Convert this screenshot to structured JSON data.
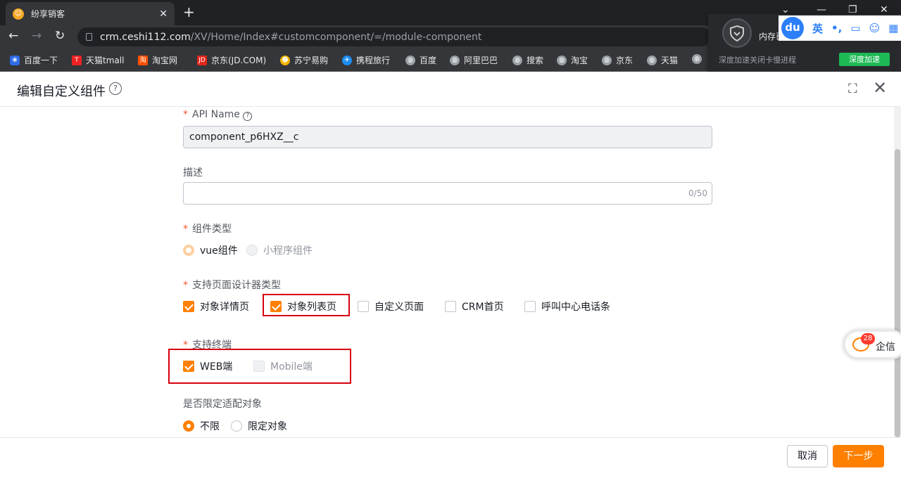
{
  "browser": {
    "tab_title": "纷享销客",
    "url_host": "crm.ceshi112.com",
    "url_path": "/XV/Home/Index#customcomponent/=/module-component",
    "bookmarks": [
      "百度一下",
      "天猫tmall",
      "淘宝网",
      "京东(JD.COM)",
      "苏宁易购",
      "携程旅行",
      "百度",
      "阿里巴巴",
      "搜索",
      "淘宝",
      "京东",
      "天猫"
    ]
  },
  "popup": {
    "text_top": "内存已",
    "text_bottom": "深度加速关闭卡慢进程",
    "button": "深度加速"
  },
  "ime": {
    "logo": "du",
    "lang": "英"
  },
  "header": {
    "title": "编辑自定义组件"
  },
  "form": {
    "api_name": {
      "label": "API Name",
      "value": "component_p6HXZ__c"
    },
    "description": {
      "label": "描述",
      "value": "",
      "counter": "0/50"
    },
    "component_type": {
      "label": "组件类型",
      "options": [
        "vue组件",
        "小程序组件"
      ]
    },
    "designer_type": {
      "label": "支持页面设计器类型",
      "options": [
        "对象详情页",
        "对象列表页",
        "自定义页面",
        "CRM首页",
        "呼叫中心电话条"
      ]
    },
    "terminal": {
      "label": "支持终端",
      "options": [
        "WEB端",
        "Mobile端"
      ]
    },
    "limit_object": {
      "label": "是否限定适配对象",
      "options": [
        "不限",
        "限定对象"
      ]
    }
  },
  "footer": {
    "cancel": "取消",
    "next": "下一步"
  },
  "qixin": {
    "label": "企信",
    "badge": "28"
  },
  "colors": {
    "accent": "#ff8000",
    "required": "#ff522a",
    "highlight": "#d7000f"
  }
}
